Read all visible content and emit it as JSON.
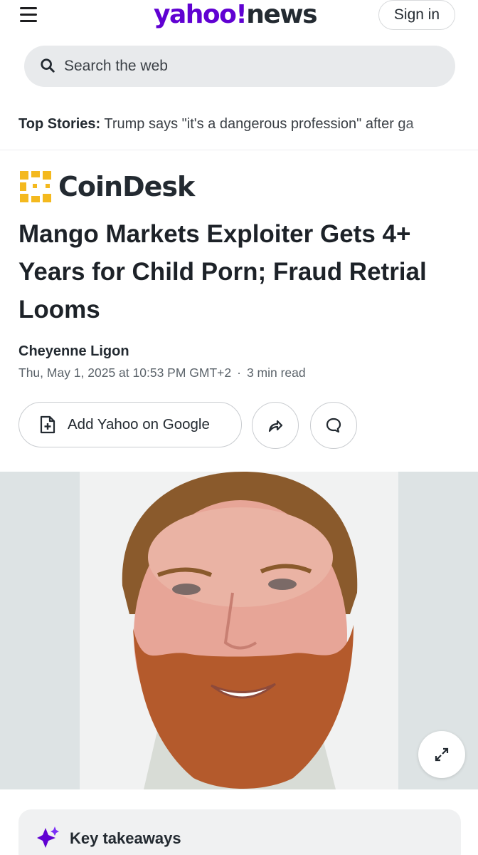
{
  "header": {
    "logo_yahoo": "yahoo",
    "logo_news": "news",
    "signin_label": "Sign in"
  },
  "search": {
    "placeholder": "Search the web"
  },
  "top_stories": {
    "label": "Top Stories:",
    "text": "Trump says \"it's a dangerous profession\" after ga"
  },
  "article": {
    "publisher": "CoinDesk",
    "headline": "Mango Markets Exploiter Gets 4+ Years for Child Porn; Fraud Retrial Looms",
    "author": "Cheyenne Ligon",
    "date": "Thu, May 1, 2025 at 10:53 PM GMT+2",
    "read_time": "3 min read"
  },
  "actions": {
    "add_label": "Add Yahoo on Google"
  },
  "takeaways": {
    "label": "Key takeaways"
  },
  "colors": {
    "brand_purple": "#6001d2",
    "coindesk_yellow": "#f4b91e",
    "text_dark": "#232a31"
  },
  "icons": [
    "menu-icon",
    "search-icon",
    "coindesk-logo-icon",
    "document-plus-icon",
    "share-icon",
    "comment-icon",
    "expand-icon",
    "sparkle-icon"
  ]
}
